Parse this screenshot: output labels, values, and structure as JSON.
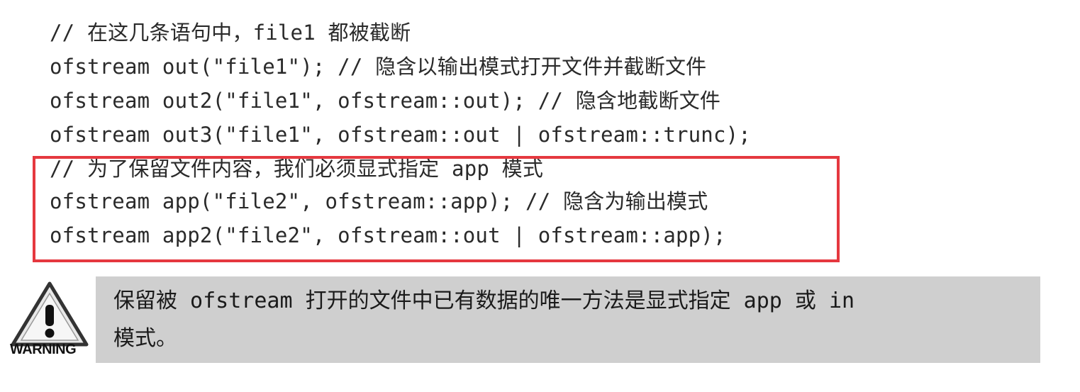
{
  "code": {
    "lines": [
      "// 在这几条语句中，file1 都被截断",
      "ofstream out(\"file1\"); // 隐含以输出模式打开文件并截断文件",
      "ofstream out2(\"file1\", ofstream::out); // 隐含地截断文件",
      "ofstream out3(\"file1\", ofstream::out | ofstream::trunc);",
      "// 为了保留文件内容，我们必须显式指定 app 模式",
      "ofstream app(\"file2\", ofstream::app); // 隐含为输出模式",
      "ofstream app2(\"file2\", ofstream::out | ofstream::app);"
    ]
  },
  "warning": {
    "label": "WARNING",
    "icon": "warning-triangle-icon",
    "text_line1": "保留被 ofstream 打开的文件中已有数据的唯一方法是显式指定 app 或 in",
    "text_line2": "模式。"
  },
  "colors": {
    "highlight_border": "#e5383f",
    "note_background": "#cfcfcf"
  }
}
